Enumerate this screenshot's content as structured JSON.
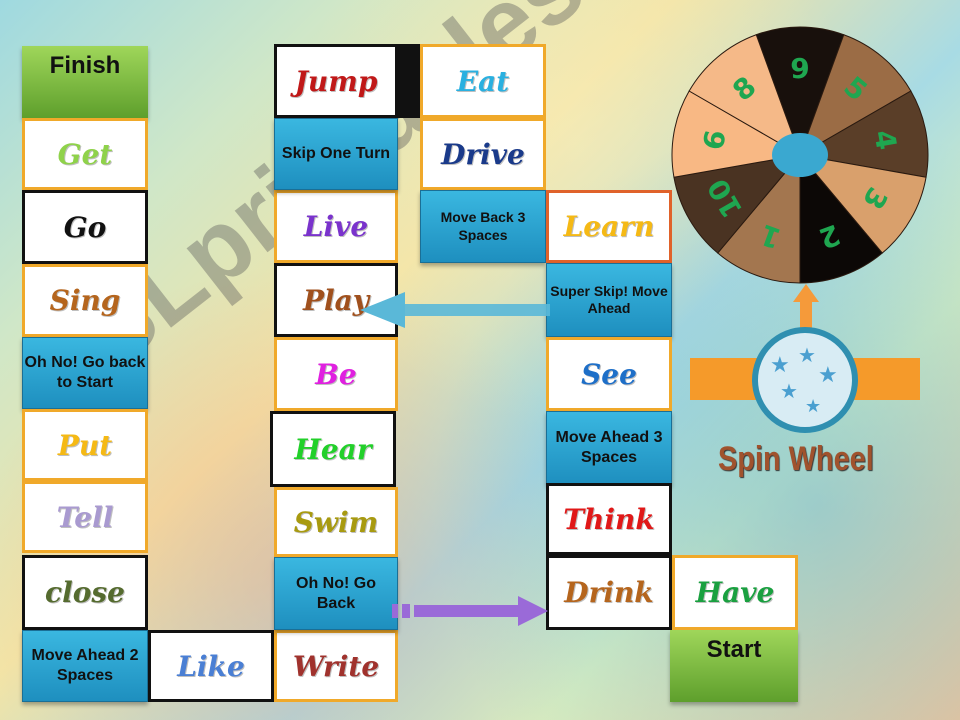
{
  "finish_label": "Finish",
  "start_label": "Start",
  "spin_label": "Spin Wheel",
  "watermark": "ESLprintables.com",
  "cells": [
    {
      "text": "Get",
      "color": "#8fd24a"
    },
    {
      "text": "Go",
      "color": "#111111"
    },
    {
      "text": "Sing",
      "color": "#b5651d"
    },
    {
      "text": "Oh No! Go back to Start",
      "type": "action"
    },
    {
      "text": "Put",
      "color": "#f5b915"
    },
    {
      "text": "Tell",
      "color": "#a99ad0"
    },
    {
      "text": "close",
      "color": "#556b2f"
    },
    {
      "text": "Move Ahead 2 Spaces",
      "type": "action"
    },
    {
      "text": "Like",
      "color": "#4a7fd4"
    },
    {
      "text": "Write",
      "color": "#a0322d"
    },
    {
      "text": "Oh No! Go Back",
      "type": "action"
    },
    {
      "text": "Swim",
      "color": "#a89a10"
    },
    {
      "text": "Hear",
      "color": "#22d02a"
    },
    {
      "text": "Be",
      "color": "#e020e0"
    },
    {
      "text": "Play",
      "color": "#a0501d"
    },
    {
      "text": "Live",
      "color": "#7a33cc"
    },
    {
      "text": "Skip One Turn",
      "type": "action"
    },
    {
      "text": "Jump",
      "color": "#c01818"
    },
    {
      "text": "Eat",
      "color": "#2ab0e0"
    },
    {
      "text": "Drive",
      "color": "#1a3a8a"
    },
    {
      "text": "Move Back 3 Spaces",
      "type": "action"
    },
    {
      "text": "Learn",
      "color": "#f5b915"
    },
    {
      "text": "Super Skip! Move Ahead",
      "type": "action"
    },
    {
      "text": "See",
      "color": "#1e6fc8"
    },
    {
      "text": "Move Ahead 3 Spaces",
      "type": "action"
    },
    {
      "text": "Think",
      "color": "#e01818"
    },
    {
      "text": "Drink",
      "color": "#b5651d"
    },
    {
      "text": "Have",
      "color": "#1aa040"
    }
  ],
  "wheel": {
    "numbers": [
      "9",
      "5",
      "4",
      "3",
      "2",
      "1",
      "10",
      "6",
      "8"
    ],
    "colors": [
      "#18100c",
      "#9b6c45",
      "#5a3e28",
      "#d9a06c",
      "#0c0806",
      "#a3764f",
      "#4a3322",
      "#f8b884",
      "#f5b988"
    ],
    "number_color": "#1fa650",
    "hub_color": "#3aa8d0"
  }
}
